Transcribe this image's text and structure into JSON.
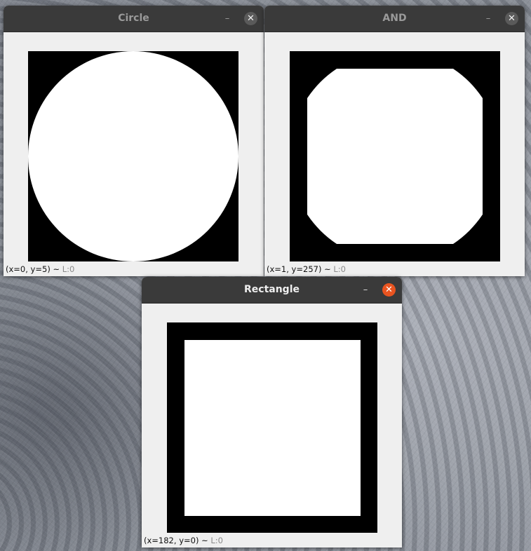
{
  "windows": {
    "circle": {
      "title": "Circle",
      "minimize_glyph": "–",
      "close_glyph": "✕",
      "status": {
        "coords": "(x=0, y=5)",
        "separator": "~",
        "level": "L:0"
      }
    },
    "and": {
      "title": "AND",
      "minimize_glyph": "–",
      "close_glyph": "✕",
      "status": {
        "coords": "(x=1, y=257)",
        "separator": "~",
        "level": "L:0"
      }
    },
    "rectangle": {
      "title": "Rectangle",
      "minimize_glyph": "–",
      "close_glyph": "✕",
      "status": {
        "coords": "(x=182, y=0)",
        "separator": "~",
        "level": "L:0"
      }
    }
  },
  "icons": {
    "minimize": "minimize-icon",
    "close": "close-icon"
  },
  "colors": {
    "titlebar": "#3a3a3a",
    "window_bg": "#efefef",
    "close_active": "#e95420",
    "close_inactive": "#5a5a5a",
    "image_background": "#000000",
    "image_foreground": "#ffffff"
  }
}
